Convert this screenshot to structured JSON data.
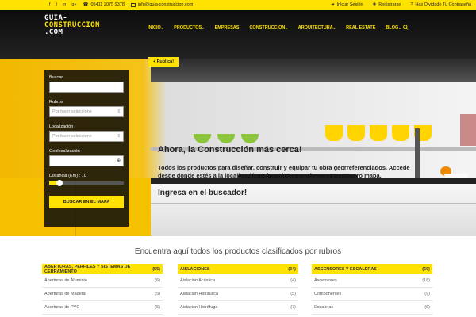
{
  "topbar": {
    "social": [
      "f",
      "t",
      "in",
      "g+"
    ],
    "phone": "05411 2075 9378",
    "email": "info@guia-construccion.com",
    "login": "Iniciar Sesión",
    "register": "Registrarse",
    "forgot": "Has Olvidado Tu Contraseña"
  },
  "header": {
    "logo_lines": [
      "GUIA-",
      "CONSTRUCCION",
      ".COM"
    ],
    "nav": [
      {
        "label": "INICIO",
        "caret": "⌄"
      },
      {
        "label": "PRODUCTOS",
        "caret": "⌄"
      },
      {
        "label": "EMPRESAS",
        "caret": ""
      },
      {
        "label": "CONSTRUCCION",
        "caret": "⌄"
      },
      {
        "label": "ARQUITECTURA",
        "caret": "⌄"
      },
      {
        "label": "REAL ESTATE",
        "caret": ""
      },
      {
        "label": "BLOG",
        "caret": "⌄"
      }
    ],
    "search_icon": "search-icon",
    "publica": "+ Publica!"
  },
  "hero": {
    "title": "Ahora, la Construcción más cerca!",
    "paragraph": "Todos los productos para diseñar, construir y equipar tu obra georreferenciados. Accede desde donde estés a la localización del producto que buscas en nuestro mapa.",
    "subtitle": "Ingresa en el buscador!"
  },
  "search": {
    "buscar_label": "Buscar",
    "rubros_label": "Rubros",
    "rubros_value": "Por favor seleccione",
    "localizacion_label": "Localización",
    "localizacion_value": "Por favor seleccione",
    "geo_label": "Geolocalización",
    "distance_label": "Distancia (Km) : 10",
    "distance_value": 10,
    "button": "BUSCAR EN EL MAPA"
  },
  "categories": {
    "title": "Encuentra aquí todos los productos clasificados por rubros",
    "columns": [
      {
        "header": "ABERTURAS, PERFILES Y SISTEMAS DE CERRAMIENTO",
        "count": "(55)",
        "items": [
          {
            "name": "Aberturas de Aluminio",
            "count": "(6)"
          },
          {
            "name": "Aberturas de Madera",
            "count": "(5)"
          },
          {
            "name": "Aberturas de PVC",
            "count": "(5)"
          }
        ]
      },
      {
        "header": "AISLACIONES",
        "count": "(34)",
        "items": [
          {
            "name": "Aislación Acústica",
            "count": "(4)"
          },
          {
            "name": "Aislación Hidráulica",
            "count": "(5)"
          },
          {
            "name": "Aislación Hidrófuga",
            "count": "(7)"
          }
        ]
      },
      {
        "header": "ASCENSORES Y ESCALERAS",
        "count": "(50)",
        "items": [
          {
            "name": "Ascensores",
            "count": "(18)"
          },
          {
            "name": "Componentes",
            "count": "(9)"
          },
          {
            "name": "Escaleras",
            "count": "(6)"
          }
        ]
      }
    ]
  }
}
